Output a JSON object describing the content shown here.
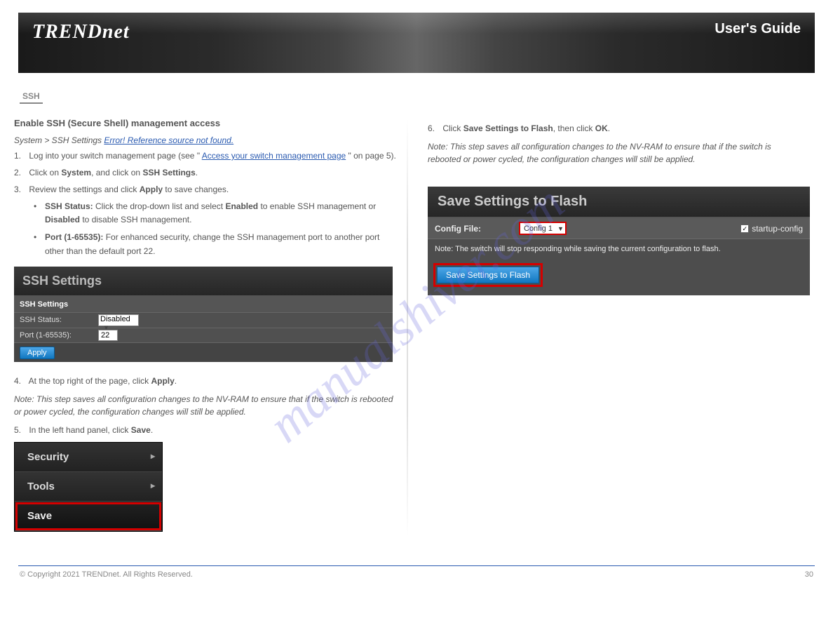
{
  "banner": {
    "brand": "TRENDnet",
    "product": "User's Guide"
  },
  "tab": "SSH",
  "left": {
    "section_title": "Enable SSH (Secure Shell) management access",
    "intro_prefix": "System > SSH Settings ",
    "intro_link": "Error! Reference source not found.",
    "steps": {
      "s1_pre": "Log into your switch management page (see \"",
      "s1_link": "Access your switch management page",
      "s1_post": "\" on page 5).",
      "s2": "Click on System, and click on SSH Settings.",
      "s3": "Review the settings and click Apply to save changes.",
      "s4": "At the top right of the page, click Apply.",
      "s4_note": "Note: This step saves all configuration changes to the NV-RAM to ensure that if the switch is rebooted or power cycled, the configuration changes will still be applied.",
      "s5": "In the left hand panel, click Save."
    },
    "bullets": {
      "b1_pre": "SSH Status: ",
      "b1_rest": "Click the drop-down list and select Enabled to enable SSH management or Disabled to disable SSH management.",
      "b2_pre": "Port (1-65535): ",
      "b2_rest": "For enhanced security, change the SSH management port to another port other than the default port 22."
    },
    "ssh_panel": {
      "title": "SSH Settings",
      "subtitle": "SSH Settings",
      "status_label": "SSH Status:",
      "status_value": "Disabled",
      "port_label": "Port (1-65535):",
      "port_value": "22",
      "apply": "Apply"
    },
    "sidebar": {
      "item1": "Security",
      "item2": "Tools",
      "item3": "Save"
    }
  },
  "right": {
    "step6": "Click Save Settings to Flash, then click OK.",
    "step6_note": "Note: This step saves all configuration changes to the NV-RAM to ensure that if the switch is rebooted or power cycled, the configuration changes will still be applied.",
    "save_panel": {
      "title": "Save Settings to Flash",
      "config_label": "Config File:",
      "config_value": "Config 1",
      "checkbox_label": "startup-config",
      "checkbox_checked": "✓",
      "note": "Note: The switch will stop responding while saving the current configuration to flash.",
      "button": "Save Settings to Flash"
    }
  },
  "watermark": "manualshiver.com",
  "footer": {
    "copyright": "© Copyright 2021 TRENDnet. All Rights Reserved.",
    "page_label": "30"
  }
}
